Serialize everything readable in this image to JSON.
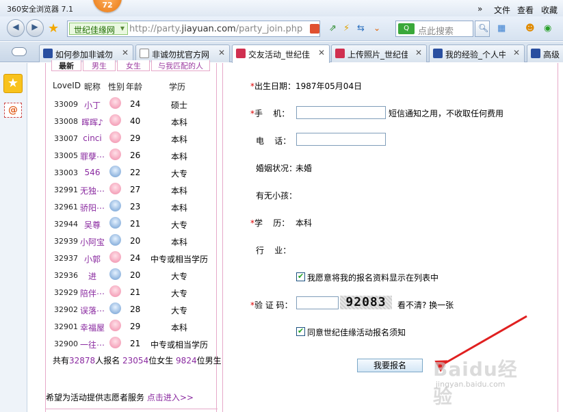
{
  "browser": {
    "title": "360安全浏览器 7.1",
    "badge": "72",
    "menu": {
      "more": "»",
      "file": "文件",
      "view": "查看",
      "favorites": "收藏"
    },
    "site_chip": "世纪佳缘网",
    "url_prefix": "http://party.",
    "url_domain": "jiayuan.com",
    "url_path": "/party_join.php",
    "search_engine": "Q",
    "search_placeholder": "点此搜索"
  },
  "tabs": [
    {
      "label": "如何参加非诚勿",
      "icon_color": "#2a4fa0",
      "active": false
    },
    {
      "label": "非诚勿扰官方网",
      "icon_color": "#ffffff",
      "active": false
    },
    {
      "label": "交友活动_世纪佳",
      "icon_color": "#d03050",
      "active": true
    },
    {
      "label": "上传照片_世纪佳",
      "icon_color": "#d03050",
      "active": false
    },
    {
      "label": "我的经验_个人中",
      "icon_color": "#2a4fa0",
      "active": false
    },
    {
      "label": "高级",
      "icon_color": "#2a4fa0",
      "active": false
    }
  ],
  "left_panel": {
    "tabs": [
      "最新",
      "男生",
      "女生",
      "与我匹配的人"
    ],
    "headers": {
      "id": "LoveID",
      "nick": "昵称",
      "gender": "性别",
      "age": "年龄",
      "edu": "学历"
    },
    "rows": [
      {
        "id": "33009",
        "nick": "小丁",
        "gender": "female",
        "age": "24",
        "edu": "硕士"
      },
      {
        "id": "33008",
        "nick": "晖晖♪",
        "gender": "female",
        "age": "40",
        "edu": "本科"
      },
      {
        "id": "33007",
        "nick": "cinci",
        "gender": "female",
        "age": "29",
        "edu": "本科"
      },
      {
        "id": "33005",
        "nick": "罪孽⋯",
        "gender": "female",
        "age": "26",
        "edu": "本科"
      },
      {
        "id": "33003",
        "nick": "546",
        "gender": "male",
        "age": "22",
        "edu": "大专"
      },
      {
        "id": "32991",
        "nick": "无独⋯",
        "gender": "female",
        "age": "27",
        "edu": "本科"
      },
      {
        "id": "32961",
        "nick": "骄阳⋯",
        "gender": "male",
        "age": "23",
        "edu": "本科"
      },
      {
        "id": "32944",
        "nick": "吴尊",
        "gender": "male",
        "age": "21",
        "edu": "大专"
      },
      {
        "id": "32939",
        "nick": "小阿宝",
        "gender": "male",
        "age": "20",
        "edu": "本科"
      },
      {
        "id": "32937",
        "nick": "小郭",
        "gender": "female",
        "age": "24",
        "edu": "中专或相当学历"
      },
      {
        "id": "32936",
        "nick": "进",
        "gender": "male",
        "age": "20",
        "edu": "大专"
      },
      {
        "id": "32929",
        "nick": "陪伴⋯",
        "gender": "female",
        "age": "21",
        "edu": "大专"
      },
      {
        "id": "32902",
        "nick": "误落⋯",
        "gender": "male",
        "age": "28",
        "edu": "大专"
      },
      {
        "id": "32901",
        "nick": "幸福屋",
        "gender": "female",
        "age": "29",
        "edu": "本科"
      },
      {
        "id": "32900",
        "nick": "一往⋯",
        "gender": "female",
        "age": "21",
        "edu": "中专或相当学历"
      }
    ],
    "summary": {
      "prefix": "共有",
      "total": "32878",
      "mid1": "人报名 ",
      "female": "23054",
      "mid2": "位女生 ",
      "male": "9824",
      "suffix": "位男生"
    },
    "volunteer_text": "希望为活动提供志愿者服务 ",
    "volunteer_link": "点击进入>>"
  },
  "form": {
    "birthday_label": "出生日期：",
    "birthday_value": "1987年05月04日",
    "mobile_label": "手    机：",
    "mobile_note": "短信通知之用，不收取任何费用",
    "phone_label": "电    话：",
    "marital_label": "婚姻状况：",
    "marital_value": "未婚",
    "children_label": "有无小孩：",
    "edu_label": "学    历：",
    "edu_value": "本科",
    "industry_label": "行    业：",
    "show_list_label": "我愿意将我的报名资料显示在列表中",
    "captcha_label": "验 证 码：",
    "captcha_image_text": "92083",
    "captcha_refresh": "看不清? 换一张",
    "agree_label": "同意世纪佳缘活动报名须知",
    "submit_label": "我要报名"
  },
  "watermark": {
    "brand": "Baidu经验",
    "domain": "jingyan.baidu.com"
  },
  "colors": {
    "accent_purple": "#8a2aa0",
    "required_red": "#dd0000",
    "arrow_red": "#e02020",
    "panel_border": "#e6a8c8"
  }
}
